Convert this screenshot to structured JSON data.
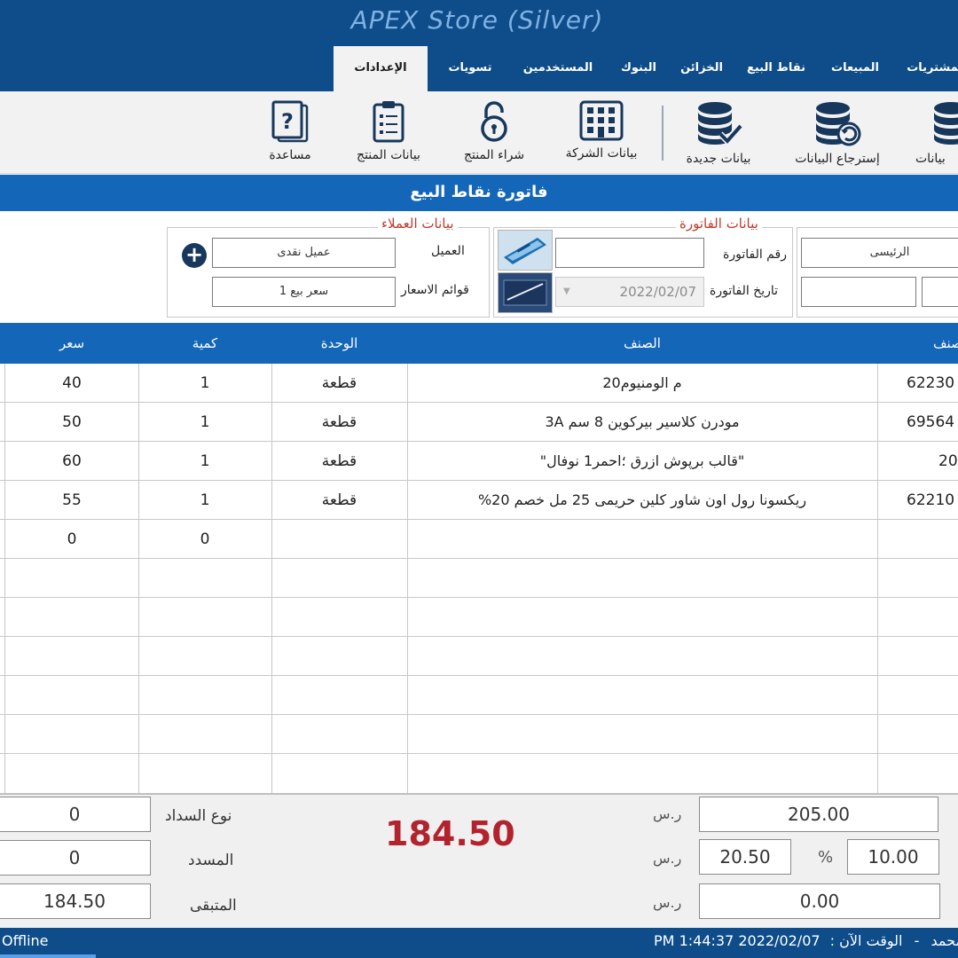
{
  "app": {
    "title": "APEX Store (Silver)"
  },
  "tabs": [
    {
      "label": "المشتريات"
    },
    {
      "label": "المبيعات"
    },
    {
      "label": "نقاط البيع"
    },
    {
      "label": "الخزائن"
    },
    {
      "label": "البنوك"
    },
    {
      "label": "المستخدمين"
    },
    {
      "label": "تسويات"
    },
    {
      "label": "الإعدادات",
      "active": true
    }
  ],
  "ribbon": {
    "buttons": [
      {
        "label": "بيانات",
        "icon": "database-icon"
      },
      {
        "label": "إسترجاع البيانات",
        "icon": "database-restore-icon"
      },
      {
        "label": "بيانات جديدة",
        "icon": "database-check-icon"
      },
      {
        "label": "بيانات الشركة",
        "icon": "building-icon"
      },
      {
        "label": "شراء المنتج",
        "icon": "lock-icon"
      },
      {
        "label": "بيانات المنتج",
        "icon": "clipboard-icon"
      },
      {
        "label": "مساعدة",
        "icon": "help-icon"
      }
    ]
  },
  "section": {
    "title": "فاتورة نقاط البيع"
  },
  "invoice": {
    "group_title": "بيانات الفاتورة",
    "number_label": "رقم الفاتورة",
    "number_value": "",
    "date_label": "تاريخ الفاتورة",
    "date_value": "2022/02/07",
    "store_value": "الرئيسى"
  },
  "customer": {
    "group_title": "بيانات العملاء",
    "customer_label": "العميل",
    "customer_value": "عميل نقدى",
    "pricelist_label": "قوائم الاسعار",
    "pricelist_value": "سعر بيع 1"
  },
  "grid": {
    "columns": {
      "price": "سعر",
      "qty": "كمية",
      "unit": "الوحدة",
      "item": "الصنف",
      "code": "كود الصنف"
    },
    "rows": [
      {
        "price": "40",
        "qty": "1",
        "unit": "قطعة",
        "item": "20م الومنيوم",
        "code": "62230"
      },
      {
        "price": "50",
        "qty": "1",
        "unit": "قطعة",
        "item": "3A مودرن كلاسير بيركوين 8 سم",
        "code": "69564"
      },
      {
        "price": "60",
        "qty": "1",
        "unit": "قطعة",
        "item": "\"قالب برپوش ازرق ؛احمر1 نوفال\"",
        "code": "20"
      },
      {
        "price": "55",
        "qty": "1",
        "unit": "قطعة",
        "item": "%ريكسونا رول اون شاور كلين حريمى 25 مل خصم 20",
        "code": "62210"
      },
      {
        "price": "0",
        "qty": "0",
        "unit": "",
        "item": "",
        "code": ""
      }
    ]
  },
  "totals": {
    "grand_total": "184.50",
    "subtotal": "205.00",
    "discount_value": "20.50",
    "discount_percent": "10.00",
    "percent_sign": "%",
    "tax": "0.00",
    "currency": "ر.س",
    "payment_type_label": "نوع السداد",
    "payment_type_value": "0",
    "paid_label": "المسدد",
    "paid_value": "0",
    "remaining_label": "المتبقى",
    "remaining_value": "184.50"
  },
  "status": {
    "left": "Offline",
    "time_label": "الوقت الآن :",
    "datetime": "PM 1:44:37 2022/02/07",
    "separator": "-",
    "user": "محمد"
  }
}
